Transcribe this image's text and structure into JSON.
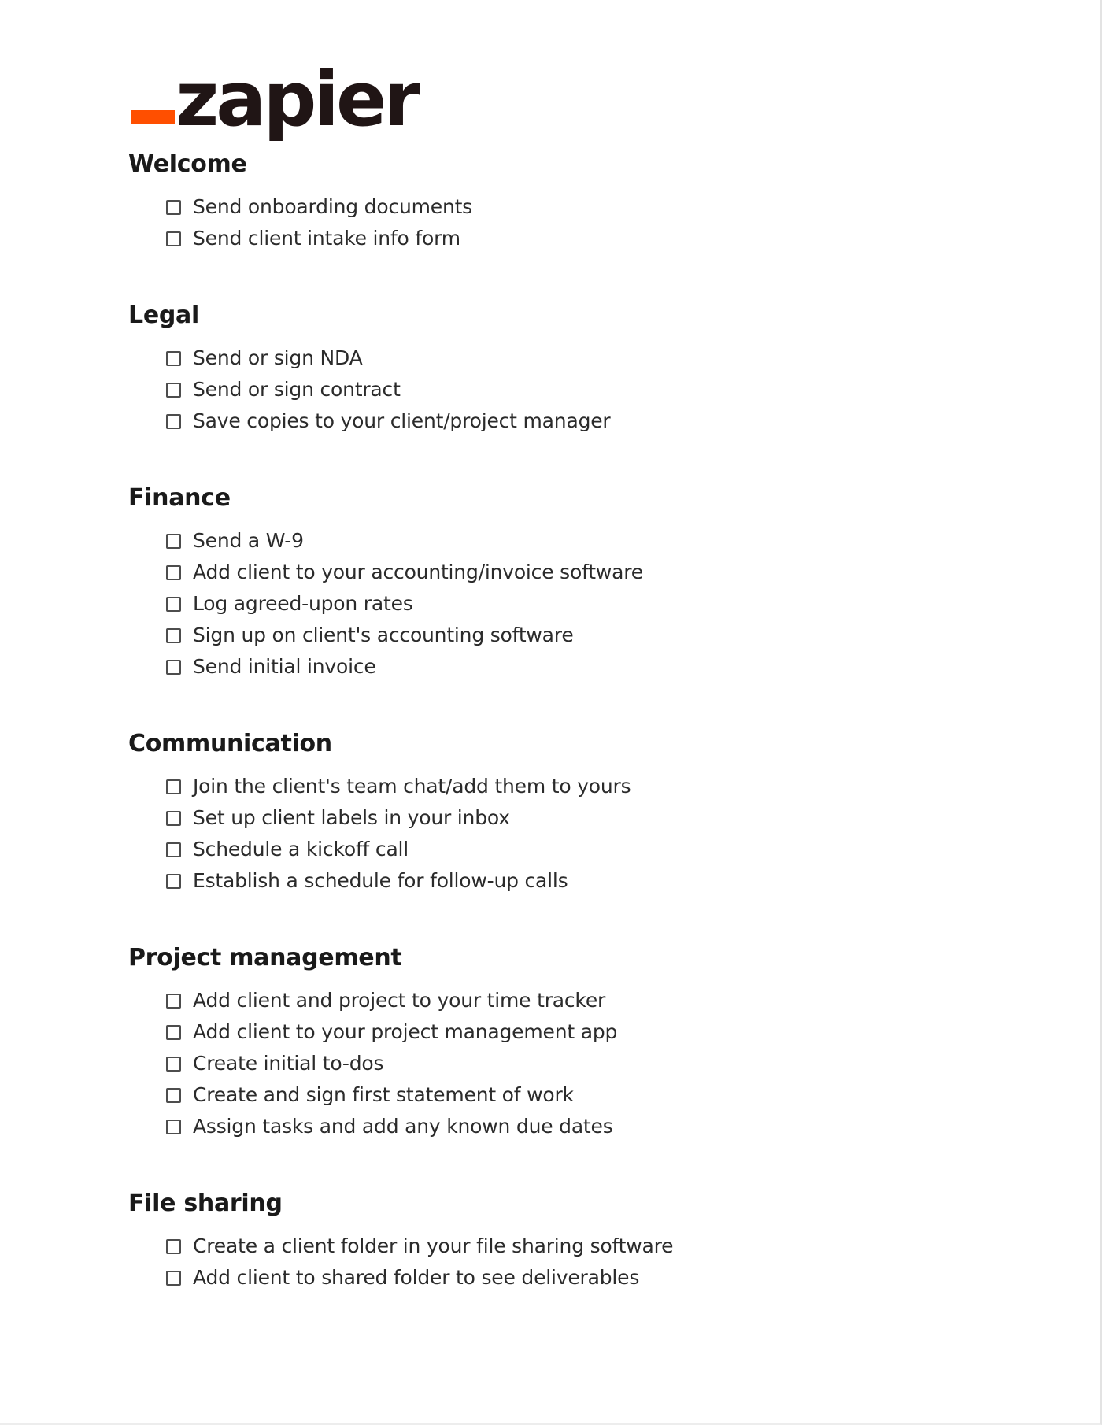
{
  "brand": {
    "logo_text": "zapier",
    "logo_mark": "underscore",
    "accent_color": "#ff4f00",
    "wordmark_color": "#201515"
  },
  "document": {
    "background_color": "#ffffff",
    "text_color": "#2b2b2b",
    "heading_color": "#1a1a1a",
    "checkbox_border_color": "#4d4d4d"
  },
  "sections": [
    {
      "heading": "Welcome",
      "items": [
        {
          "label": "Send onboarding documents",
          "checked": false
        },
        {
          "label": "Send client intake info form",
          "checked": false
        }
      ]
    },
    {
      "heading": "Legal",
      "items": [
        {
          "label": "Send or sign NDA",
          "checked": false
        },
        {
          "label": "Send or sign contract",
          "checked": false
        },
        {
          "label": "Save copies to your client/project manager",
          "checked": false
        }
      ]
    },
    {
      "heading": "Finance",
      "items": [
        {
          "label": "Send a W-9",
          "checked": false
        },
        {
          "label": "Add client to your accounting/invoice software",
          "checked": false
        },
        {
          "label": "Log agreed-upon rates",
          "checked": false
        },
        {
          "label": "Sign up on client's accounting software",
          "checked": false
        },
        {
          "label": "Send initial invoice",
          "checked": false
        }
      ]
    },
    {
      "heading": "Communication",
      "items": [
        {
          "label": "Join the client's team chat/add them to yours",
          "checked": false
        },
        {
          "label": "Set up client labels in your inbox",
          "checked": false
        },
        {
          "label": "Schedule a kickoff call",
          "checked": false
        },
        {
          "label": "Establish a schedule for follow-up calls",
          "checked": false
        }
      ]
    },
    {
      "heading": "Project management",
      "items": [
        {
          "label": "Add client and project to your time tracker",
          "checked": false
        },
        {
          "label": "Add client to your project management app",
          "checked": false
        },
        {
          "label": "Create initial to-dos",
          "checked": false
        },
        {
          "label": "Create and sign first statement of work",
          "checked": false
        },
        {
          "label": "Assign tasks and add any known due dates",
          "checked": false
        }
      ]
    },
    {
      "heading": "File sharing",
      "items": [
        {
          "label": "Create a client folder in your file sharing software",
          "checked": false
        },
        {
          "label": "Add client to shared folder to see deliverables",
          "checked": false
        }
      ]
    }
  ]
}
